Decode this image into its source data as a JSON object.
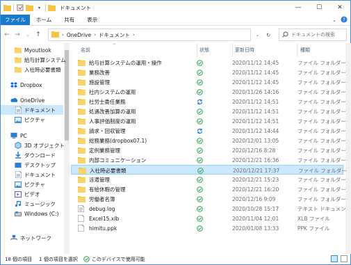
{
  "window": {
    "title": "ドキュメント"
  },
  "ribbon": {
    "tabs": [
      "ファイル",
      "ホーム",
      "共有",
      "表示"
    ]
  },
  "address": {
    "crumbs": [
      "OneDrive",
      "ドキュメント"
    ]
  },
  "search": {
    "placeholder": "ドキュメントの検索"
  },
  "sidebar": {
    "items": [
      {
        "label": "Myoutlook",
        "icon": "folder-icon",
        "indent": 1
      },
      {
        "label": "給与計算システム",
        "icon": "folder-icon",
        "indent": 1
      },
      {
        "label": "入社時必要書類",
        "icon": "folder-icon",
        "indent": 1
      },
      {
        "label": "Dropbox",
        "icon": "dropbox-icon",
        "indent": 0
      },
      {
        "label": "OneDrive",
        "icon": "onedrive-icon",
        "indent": 0
      },
      {
        "label": "ドキュメント",
        "icon": "documents-icon",
        "indent": 1
      },
      {
        "label": "ピクチャ",
        "icon": "pictures-icon",
        "indent": 1
      },
      {
        "label": "PC",
        "icon": "pc-icon",
        "indent": 0
      },
      {
        "label": "3D オブジェクト",
        "icon": "3d-objects-icon",
        "indent": 1
      },
      {
        "label": "ダウンロード",
        "icon": "downloads-icon",
        "indent": 1
      },
      {
        "label": "デスクトップ",
        "icon": "desktop-icon",
        "indent": 1
      },
      {
        "label": "ドキュメント",
        "icon": "documents-icon",
        "indent": 1
      },
      {
        "label": "ピクチャ",
        "icon": "pictures-icon",
        "indent": 1
      },
      {
        "label": "ビデオ",
        "icon": "videos-icon",
        "indent": 1
      },
      {
        "label": "ミュージック",
        "icon": "music-icon",
        "indent": 1
      },
      {
        "label": "Windows (C:)",
        "icon": "drive-icon",
        "indent": 1
      },
      {
        "label": "ネットワーク",
        "icon": "network-icon",
        "indent": 0
      }
    ]
  },
  "columns": {
    "name": "名前",
    "status": "状態",
    "date": "更新日時",
    "type": "種類"
  },
  "files": [
    {
      "name": "給与計算システムの運用・操作",
      "status": "synced",
      "date": "2020/11/12 14:45",
      "type": "ファイル フォルダー",
      "icon": "folder-icon"
    },
    {
      "name": "業務改善",
      "status": "synced",
      "date": "2020/11/12 14:45",
      "type": "ファイル フォルダー",
      "icon": "folder-icon"
    },
    {
      "name": "施設管理",
      "status": "synced",
      "date": "2020/11/12 14:45",
      "type": "ファイル フォルダー",
      "icon": "folder-icon"
    },
    {
      "name": "社内システムの運用",
      "status": "synced",
      "date": "2020/11/26 14:16",
      "type": "ファイル フォルダー",
      "icon": "folder-icon"
    },
    {
      "name": "社労士委任業務",
      "status": "syncing",
      "date": "2020/11/12 14:51",
      "type": "ファイル フォルダー",
      "icon": "folder-icon"
    },
    {
      "name": "処遇改善加算の運用",
      "status": "synced",
      "date": "2020/11/12 14:51",
      "type": "ファイル フォルダー",
      "icon": "folder-icon"
    },
    {
      "name": "人事評価制度の運用",
      "status": "synced",
      "date": "2020/11/12 14:51",
      "type": "ファイル フォルダー",
      "icon": "folder-icon"
    },
    {
      "name": "請求・回収管理",
      "status": "syncing",
      "date": "2020/11/12 14:44",
      "type": "ファイル フォルダー",
      "icon": "folder-icon"
    },
    {
      "name": "総務業務(dropbox07.1)",
      "status": "synced",
      "date": "2020/12/01 13:05",
      "type": "ファイル フォルダー",
      "icon": "folder-icon"
    },
    {
      "name": "定例業務管理",
      "status": "synced",
      "date": "2020/12/16 8:28",
      "type": "ファイル フォルダー",
      "icon": "folder-icon"
    },
    {
      "name": "内部コミュニケーション",
      "status": "synced",
      "date": "2020/12/21 16:36",
      "type": "ファイル フォルダー",
      "icon": "folder-icon"
    },
    {
      "name": "入社時必要書類",
      "status": "synced",
      "date": "2020/12/21 17:37",
      "type": "ファイル フォルダー",
      "icon": "folder-icon",
      "selected": true
    },
    {
      "name": "派遣管理",
      "status": "synced",
      "date": "2020/12/21 15:23",
      "type": "ファイル フォルダー",
      "icon": "folder-icon"
    },
    {
      "name": "有給休暇の管理",
      "status": "synced",
      "date": "2020/12/21 16:20",
      "type": "ファイル フォルダー",
      "icon": "folder-icon"
    },
    {
      "name": "労働者名簿",
      "status": "synced",
      "date": "2020/12/16 9:09",
      "type": "ファイル フォルダー",
      "icon": "folder-icon"
    },
    {
      "name": "debug.log",
      "status": "synced",
      "date": "2020/10/28 15:17",
      "type": "テキスト ドキュメント",
      "icon": "text-file-icon"
    },
    {
      "name": "Excel15.xlb",
      "status": "synced",
      "date": "2020/11/04 12:01",
      "type": "XLB ファイル",
      "icon": "file-icon"
    },
    {
      "name": "himitu.ppk",
      "status": "synced",
      "date": "2020/01/08 13:33",
      "type": "PPK ファイル",
      "icon": "file-icon"
    }
  ],
  "statusbar": {
    "count": "18 個の項目",
    "selected": "1 個の項目を選択",
    "available": "このデバイスで使用可能"
  },
  "colors": {
    "accent": "#1979ca",
    "folder": "#f6c446",
    "sync_green": "#2e9e4f",
    "sync_blue": "#2a7fd4",
    "selection": "#cce8ff"
  }
}
